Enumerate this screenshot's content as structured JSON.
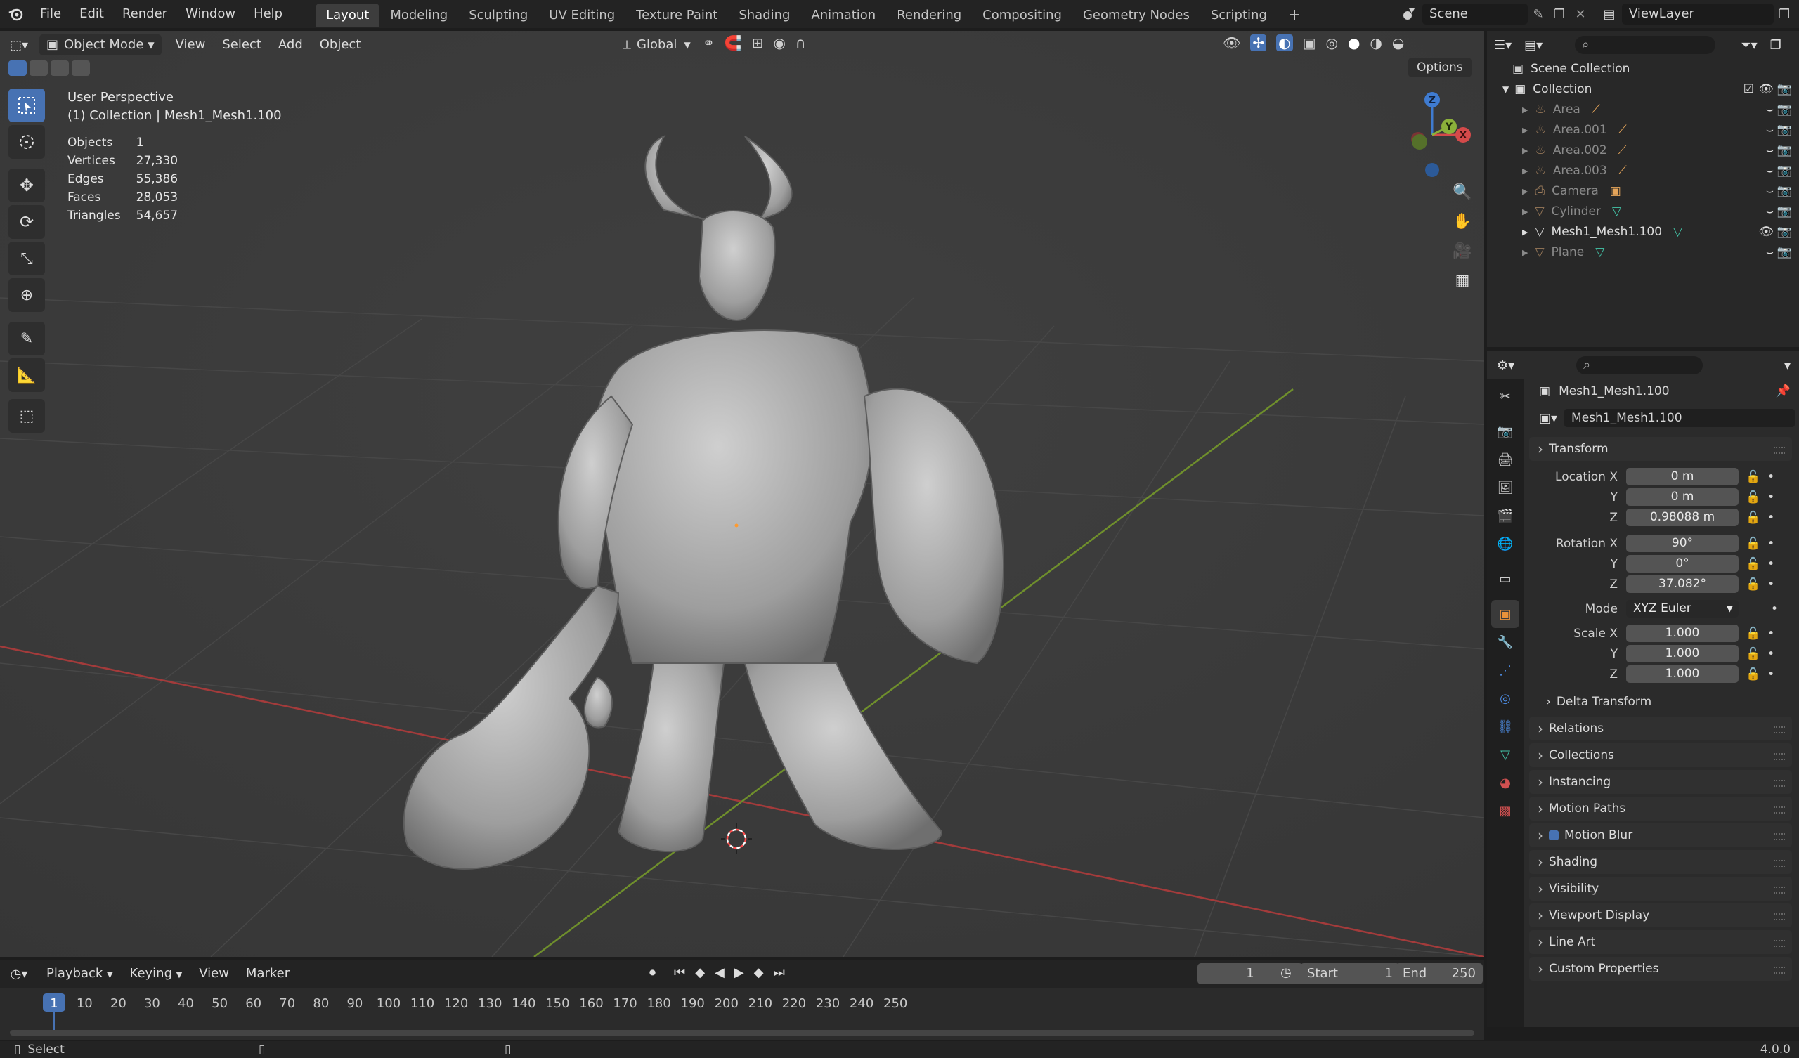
{
  "topbar": {
    "menus": [
      "File",
      "Edit",
      "Render",
      "Window",
      "Help"
    ],
    "workspaces": [
      "Layout",
      "Modeling",
      "Sculpting",
      "UV Editing",
      "Texture Paint",
      "Shading",
      "Animation",
      "Rendering",
      "Compositing",
      "Geometry Nodes",
      "Scripting"
    ],
    "active_workspace": "Layout",
    "add_tab": "+",
    "scene": "Scene",
    "view_layer": "ViewLayer"
  },
  "viewport": {
    "mode": "Object Mode",
    "menus": [
      "View",
      "Select",
      "Add",
      "Object"
    ],
    "orientation": "Global",
    "options": "Options",
    "perspective": "User Perspective",
    "collection_info": "(1) Collection | Mesh1_Mesh1.100",
    "stats": [
      {
        "label": "Objects",
        "value": "1"
      },
      {
        "label": "Vertices",
        "value": "27,330"
      },
      {
        "label": "Edges",
        "value": "55,386"
      },
      {
        "label": "Faces",
        "value": "28,053"
      },
      {
        "label": "Triangles",
        "value": "54,657"
      }
    ],
    "gizmo": {
      "z": "Z",
      "y": "Y",
      "x": "X"
    }
  },
  "outliner": {
    "scene_collection": "Scene Collection",
    "collection": "Collection",
    "items": [
      {
        "name": "Area",
        "icon": "light-icon"
      },
      {
        "name": "Area.001",
        "icon": "light-icon"
      },
      {
        "name": "Area.002",
        "icon": "light-icon"
      },
      {
        "name": "Area.003",
        "icon": "light-icon"
      },
      {
        "name": "Camera",
        "icon": "camera-icon"
      },
      {
        "name": "Cylinder",
        "icon": "mesh-icon"
      },
      {
        "name": "Mesh1_Mesh1.100",
        "icon": "mesh-icon",
        "active": true
      },
      {
        "name": "Plane",
        "icon": "mesh-icon"
      }
    ]
  },
  "properties": {
    "object_name": "Mesh1_Mesh1.100",
    "object_field": "Mesh1_Mesh1.100",
    "transform_title": "Transform",
    "location_label": "Location X",
    "location": [
      "0 m",
      "0 m",
      "0.98088 m"
    ],
    "rotation_label": "Rotation X",
    "rotation": [
      "90°",
      "0°",
      "37.082°"
    ],
    "mode_label": "Mode",
    "mode_value": "XYZ Euler",
    "scale_label": "Scale X",
    "scale": [
      "1.000",
      "1.000",
      "1.000"
    ],
    "y_label": "Y",
    "z_label": "Z",
    "delta_transform": "Delta Transform",
    "panels": [
      "Relations",
      "Collections",
      "Instancing",
      "Motion Paths",
      "Motion Blur",
      "Shading",
      "Visibility",
      "Viewport Display",
      "Line Art",
      "Custom Properties"
    ]
  },
  "timeline": {
    "menus": [
      "Playback",
      "Keying",
      "View",
      "Marker"
    ],
    "current_frame": "1",
    "start_label": "Start",
    "start": "1",
    "end_label": "End",
    "end": "250",
    "ticks": [
      "1",
      "10",
      "20",
      "30",
      "40",
      "50",
      "60",
      "70",
      "80",
      "90",
      "100",
      "110",
      "120",
      "130",
      "140",
      "150",
      "160",
      "170",
      "180",
      "190",
      "200",
      "210",
      "220",
      "230",
      "240",
      "250"
    ]
  },
  "statusbar": {
    "select": "Select",
    "version": "4.0.0"
  },
  "colors": {
    "accent": "#4772b3",
    "x_axis": "#d44a4a",
    "y_axis": "#8bb13a",
    "z_axis": "#3f7bd0",
    "mesh_icon": "#43c6a9",
    "light_icon": "#e5a55a"
  }
}
